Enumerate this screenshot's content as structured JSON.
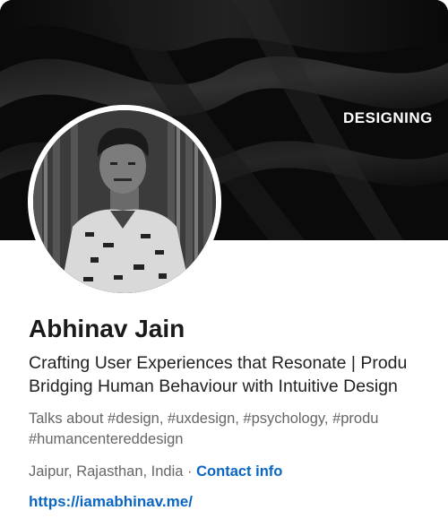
{
  "profile": {
    "banner_text": "DESIGNING",
    "name": "Abhinav Jain",
    "headline_line1": "Crafting User Experiences that Resonate | Produ",
    "headline_line2": "Bridging Human Behaviour with Intuitive Design",
    "talks_line1": "Talks about #design, #uxdesign, #psychology, #produ",
    "talks_line2": "#humancentereddesign",
    "location": "Jaipur, Rajasthan, India",
    "separator": " · ",
    "contact_label": "Contact info",
    "website": "https://iamabhinav.me/"
  },
  "colors": {
    "link": "#0a66c2",
    "banner_bg": "#0b0b0b"
  }
}
